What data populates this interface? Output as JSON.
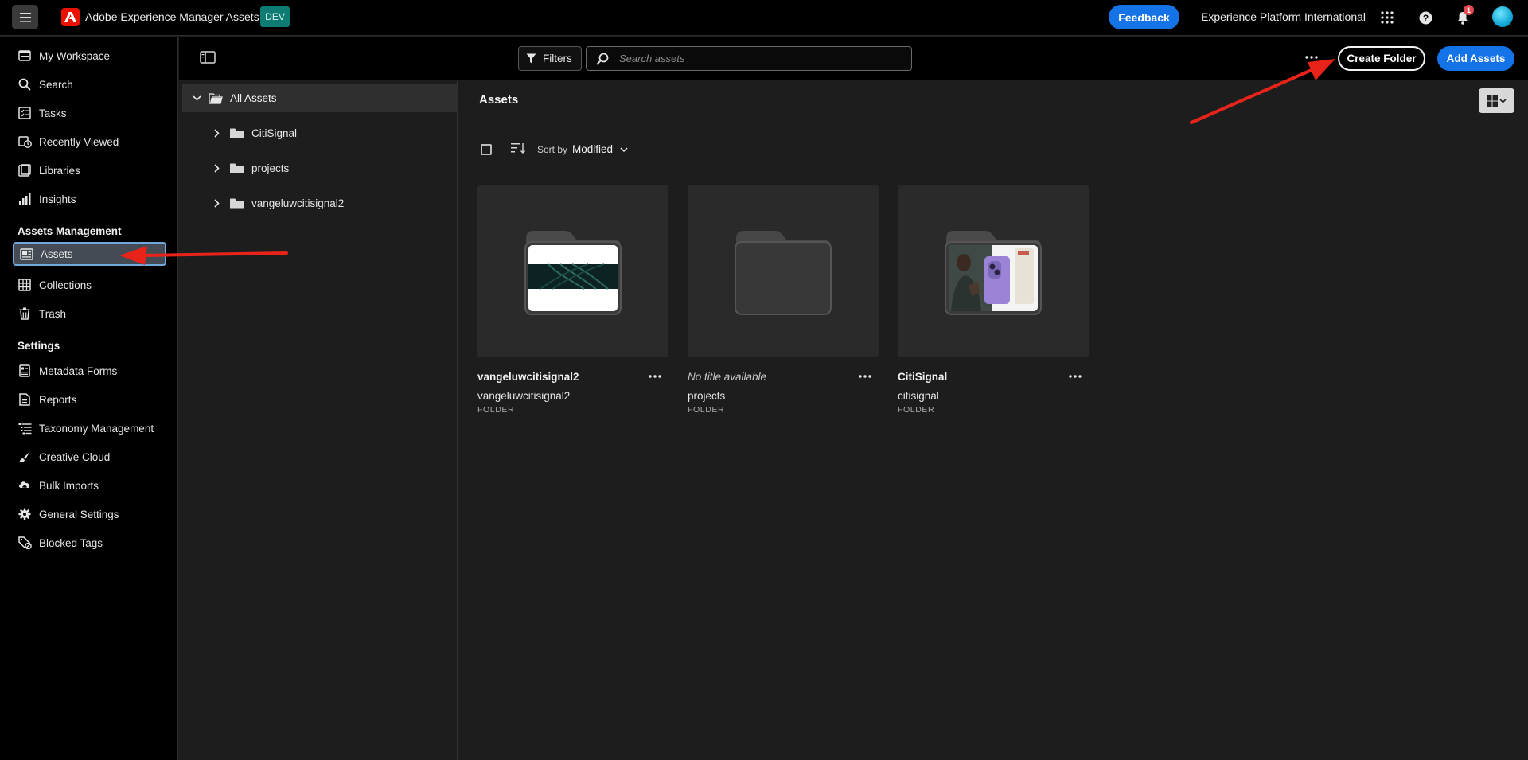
{
  "topbar": {
    "app_title": "Adobe Experience Manager Assets",
    "env_badge": "DEV",
    "feedback_label": "Feedback",
    "org_name": "Experience Platform International",
    "notification_count": "1",
    "icons": [
      "menu-icon",
      "adobe-logo-icon",
      "apps-grid-icon",
      "help-icon",
      "bell-icon"
    ]
  },
  "sidebar": {
    "items": [
      {
        "label": "My Workspace",
        "icon": "workspace-icon"
      },
      {
        "label": "Search",
        "icon": "search-icon"
      },
      {
        "label": "Tasks",
        "icon": "tasks-icon"
      },
      {
        "label": "Recently Viewed",
        "icon": "recent-icon"
      },
      {
        "label": "Libraries",
        "icon": "libraries-icon"
      },
      {
        "label": "Insights",
        "icon": "insights-icon"
      }
    ],
    "assets_management_heading": "Assets Management",
    "management_items": [
      {
        "label": "Assets",
        "icon": "assets-icon",
        "active": true
      },
      {
        "label": "Collections",
        "icon": "collections-icon"
      },
      {
        "label": "Trash",
        "icon": "trash-icon"
      }
    ],
    "settings_heading": "Settings",
    "settings_items": [
      {
        "label": "Metadata Forms",
        "icon": "metadata-forms-icon"
      },
      {
        "label": "Reports",
        "icon": "reports-icon"
      },
      {
        "label": "Taxonomy Management",
        "icon": "taxonomy-icon"
      },
      {
        "label": "Creative Cloud",
        "icon": "creative-cloud-icon"
      },
      {
        "label": "Bulk Imports",
        "icon": "bulk-imports-icon"
      },
      {
        "label": "General Settings",
        "icon": "gear-icon"
      },
      {
        "label": "Blocked Tags",
        "icon": "blocked-tags-icon"
      }
    ]
  },
  "toolbar": {
    "filters_label": "Filters",
    "search_placeholder": "Search assets",
    "create_folder_label": "Create Folder",
    "add_assets_label": "Add Assets"
  },
  "tree": {
    "root_label": "All Assets",
    "nodes": [
      {
        "label": "CitiSignal"
      },
      {
        "label": "projects"
      },
      {
        "label": "vangeluwcitisignal2"
      }
    ]
  },
  "main": {
    "title": "Assets",
    "sort_by_label": "Sort by",
    "sort_value": "Modified",
    "cards": [
      {
        "title": "vangeluwcitisignal2",
        "name": "vangeluwcitisignal2",
        "type": "FOLDER",
        "thumb": "network"
      },
      {
        "title": "No title available",
        "name": "projects",
        "type": "FOLDER",
        "thumb": "empty"
      },
      {
        "title": "CitiSignal",
        "name": "citisignal",
        "type": "FOLDER",
        "thumb": "phone"
      }
    ]
  },
  "colors": {
    "accent_blue": "#1473e6",
    "adobe_red": "#eb1000",
    "env_teal": "#0f7c73",
    "annotation_red": "#e8241a"
  }
}
